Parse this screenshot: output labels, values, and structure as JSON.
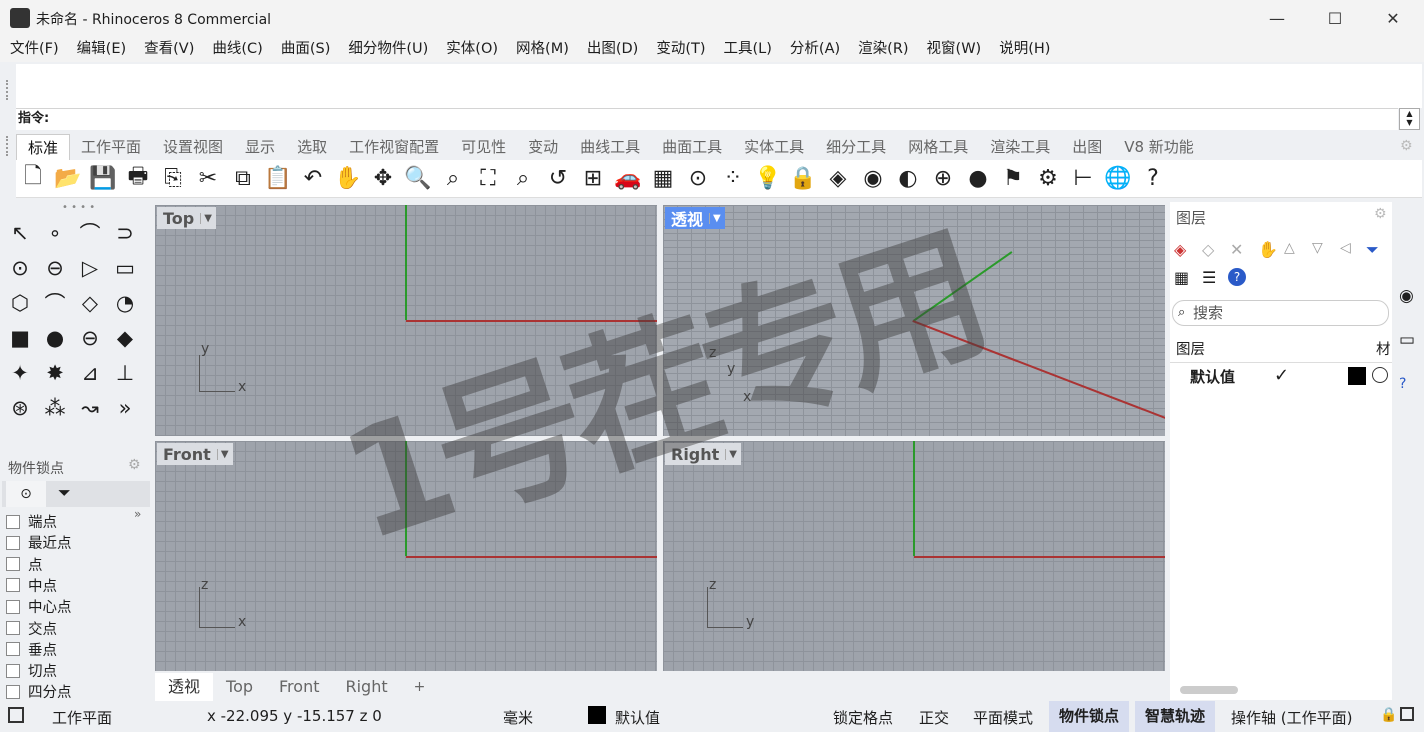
{
  "window": {
    "title": "未命名 - Rhinoceros 8 Commercial",
    "minimize": "—",
    "maximize": "☐",
    "close": "✕"
  },
  "menu": [
    "文件(F)",
    "编辑(E)",
    "查看(V)",
    "曲线(C)",
    "曲面(S)",
    "细分物件(U)",
    "实体(O)",
    "网格(M)",
    "出图(D)",
    "变动(T)",
    "工具(L)",
    "分析(A)",
    "渲染(R)",
    "视窗(W)",
    "说明(H)"
  ],
  "command": {
    "prompt": "指令:"
  },
  "toolbar_tabs": [
    "标准",
    "工作平面",
    "设置视图",
    "显示",
    "选取",
    "工作视窗配置",
    "可见性",
    "变动",
    "曲线工具",
    "曲面工具",
    "实体工具",
    "细分工具",
    "网格工具",
    "渲染工具",
    "出图",
    "V8 新功能"
  ],
  "toolbar_icons": [
    {
      "name": "new-file",
      "glyph": "🗋"
    },
    {
      "name": "open-folder",
      "glyph": "📂"
    },
    {
      "name": "save",
      "glyph": "💾"
    },
    {
      "name": "print",
      "glyph": "🖶"
    },
    {
      "name": "import",
      "glyph": "⎘"
    },
    {
      "name": "cut",
      "glyph": "✂"
    },
    {
      "name": "copy",
      "glyph": "⧉"
    },
    {
      "name": "paste",
      "glyph": "📋"
    },
    {
      "name": "undo",
      "glyph": "↶"
    },
    {
      "name": "pan-hand",
      "glyph": "✋"
    },
    {
      "name": "rotate-view",
      "glyph": "✥"
    },
    {
      "name": "zoom",
      "glyph": "🔍"
    },
    {
      "name": "zoom-window",
      "glyph": "⌕"
    },
    {
      "name": "zoom-extents",
      "glyph": "⛶"
    },
    {
      "name": "zoom-selected",
      "glyph": "⌕"
    },
    {
      "name": "undo-view",
      "glyph": "↺"
    },
    {
      "name": "four-viewports",
      "glyph": "⊞"
    },
    {
      "name": "car",
      "glyph": "🚗"
    },
    {
      "name": "grid-plane",
      "glyph": "▦"
    },
    {
      "name": "osnap",
      "glyph": "⊙"
    },
    {
      "name": "points",
      "glyph": "⁘"
    },
    {
      "name": "light-bulb",
      "glyph": "💡"
    },
    {
      "name": "lock",
      "glyph": "🔒"
    },
    {
      "name": "layer",
      "glyph": "◈"
    },
    {
      "name": "color-wheel",
      "glyph": "◉"
    },
    {
      "name": "shaded-sphere",
      "glyph": "◐"
    },
    {
      "name": "wireframe-sphere",
      "glyph": "⊕"
    },
    {
      "name": "render-sphere",
      "glyph": "●"
    },
    {
      "name": "flag",
      "glyph": "⚑"
    },
    {
      "name": "gear",
      "glyph": "⚙"
    },
    {
      "name": "dimension",
      "glyph": "⊢"
    },
    {
      "name": "earth",
      "glyph": "🌐"
    },
    {
      "name": "help",
      "glyph": "?"
    }
  ],
  "left_tools": [
    "↖",
    "∘",
    "⌒",
    "⊃",
    "⊙",
    "⊖",
    "▷",
    "▭",
    "⬡",
    "⌒",
    "◇",
    "◔",
    "■",
    "●",
    "⊖",
    "◆",
    "✦",
    "✸",
    "⊿",
    "⊥",
    "⊛",
    "⁂",
    "↝",
    "»"
  ],
  "osnap": {
    "title": "物件锁点",
    "items": [
      "端点",
      "最近点",
      "点",
      "中点",
      "中心点",
      "交点",
      "垂点",
      "切点",
      "四分点"
    ]
  },
  "viewports": [
    {
      "label": "Top",
      "axes": [
        "y",
        "x"
      ]
    },
    {
      "label": "透视",
      "axes": [
        "z",
        "y",
        "x"
      ]
    },
    {
      "label": "Front",
      "axes": [
        "z",
        "x"
      ]
    },
    {
      "label": "Right",
      "axes": [
        "z",
        "y"
      ]
    }
  ],
  "watermark": "1号茬专用",
  "viewport_tabs": [
    "透视",
    "Top",
    "Front",
    "Right",
    "+"
  ],
  "layers": {
    "title": "图层",
    "search_placeholder": "搜索",
    "header": "图层",
    "header_mat": "材",
    "default_layer": "默认值",
    "check": "✓"
  },
  "status": {
    "cplane": "工作平面",
    "coords": "x -22.095   y -15.157   z 0",
    "units": "毫米",
    "layer": "默认值",
    "grid_snap": "锁定格点",
    "ortho": "正交",
    "planar": "平面模式",
    "osnap": "物件锁点",
    "smarttrack": "智慧轨迹",
    "gumball": "操作轴 (工作平面)"
  }
}
